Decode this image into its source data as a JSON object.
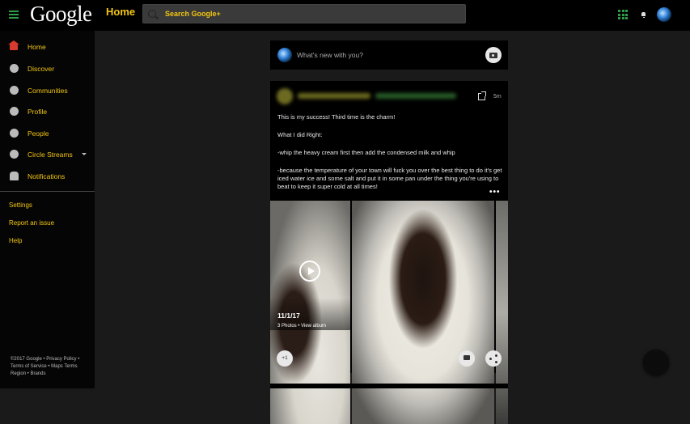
{
  "header": {
    "logo": "Google",
    "page_title": "Home",
    "search_placeholder": "Search Google+"
  },
  "sidebar": {
    "items": [
      {
        "label": "Home",
        "icon": "home-icon"
      },
      {
        "label": "Discover",
        "icon": "compass-icon"
      },
      {
        "label": "Communities",
        "icon": "communities-icon"
      },
      {
        "label": "Profile",
        "icon": "profile-icon"
      },
      {
        "label": "People",
        "icon": "people-icon"
      },
      {
        "label": "Circle Streams",
        "icon": "circles-icon"
      },
      {
        "label": "Notifications",
        "icon": "bell-icon"
      }
    ],
    "links": [
      "Settings",
      "Report an issue",
      "Help"
    ],
    "footer": "©2017 Google • Privacy Policy • Terms of Service • Maps Terms Region • Brands"
  },
  "compose": {
    "placeholder": "What's new with you?"
  },
  "post": {
    "time": "5m",
    "paragraphs": [
      "This is my success! Third time is the charm!",
      "What I did Right:",
      "-whip the heavy cream first then add the condensed milk and whip",
      "-because the temperature of your town will fuck you over the best thing to do it's get iced water ice and some salt and put it in some pan under the thing you're using to beat to keep it super cold at all times!"
    ],
    "album_date": "11/1/17",
    "album_caption": "3 Photos • View album",
    "plus_one": "+1"
  },
  "colors": {
    "accent": "#f3c611",
    "menu_green": "#2e9e48",
    "background": "#1a1a1a",
    "card": "#000000"
  }
}
